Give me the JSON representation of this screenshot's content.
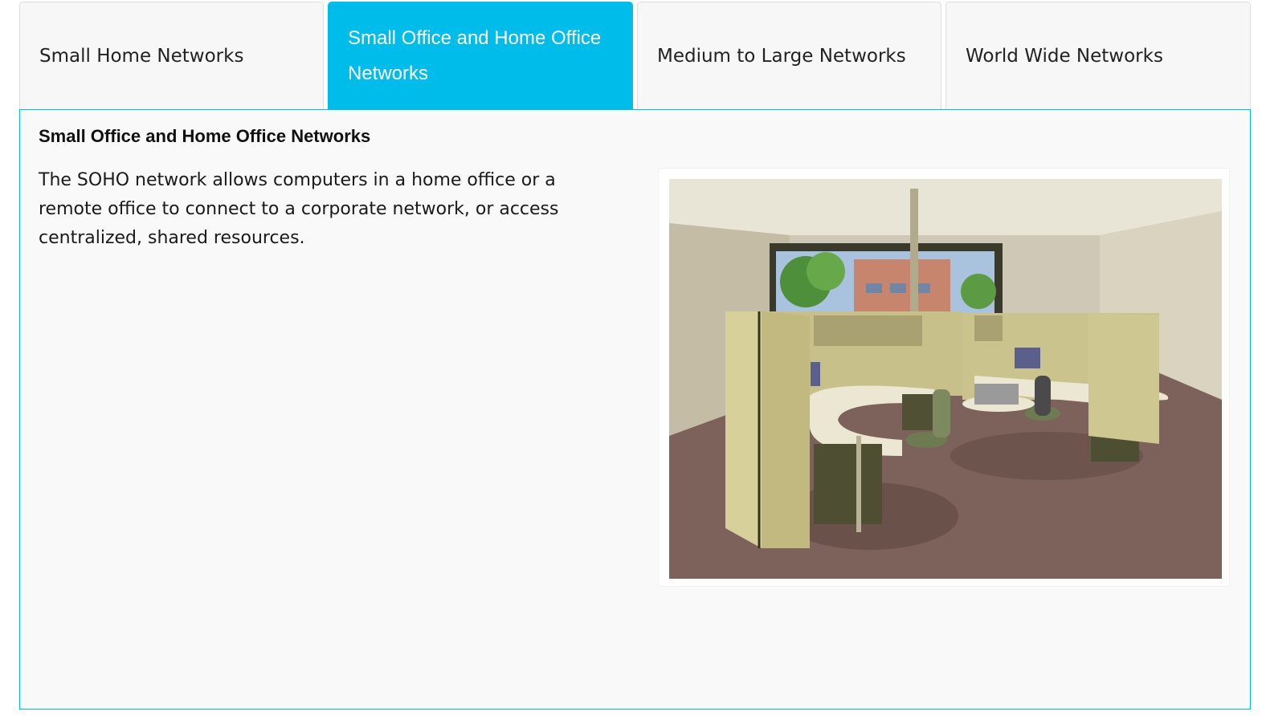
{
  "tabs": [
    {
      "label": "Small Home Networks",
      "active": false
    },
    {
      "label": "Small Office and Home Office Networks",
      "active": true
    },
    {
      "label": "Medium to Large Networks",
      "active": false
    },
    {
      "label": "World Wide Networks",
      "active": false
    }
  ],
  "panel": {
    "title": "Small Office and Home Office Networks",
    "body": "The SOHO network allows computers in a home office or a remote office to connect to a corporate network, or access centralized, shared resources.",
    "image": "office-cubicles-illustration"
  },
  "colors": {
    "accent": "#00bceb",
    "tab_bg": "#f7f7f7",
    "panel_bg": "#f9f9f9"
  }
}
